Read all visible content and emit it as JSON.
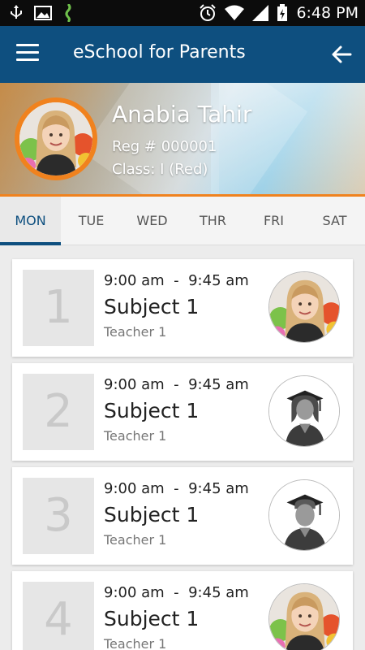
{
  "status_bar": {
    "time": "6:48 PM",
    "icons": [
      "usb-icon",
      "image-icon",
      "app-notification-icon",
      "alarm-icon",
      "wifi-icon",
      "signal-icon",
      "battery-charging-icon"
    ]
  },
  "app_bar": {
    "title": "eSchool for Parents",
    "menu_icon": "hamburger-menu-icon",
    "back_icon": "arrow-back-icon",
    "color": "#0e4f7f"
  },
  "profile": {
    "name": "Anabia Tahir",
    "reg": "Reg # 000001",
    "class": "Class: I (Red)",
    "ring_color": "#f0821e"
  },
  "tabs": [
    {
      "label": "MON",
      "active": true
    },
    {
      "label": "TUE",
      "active": false
    },
    {
      "label": "WED",
      "active": false
    },
    {
      "label": "THR",
      "active": false
    },
    {
      "label": "FRI",
      "active": false
    },
    {
      "label": "SAT",
      "active": false
    }
  ],
  "schedule": [
    {
      "period": "1",
      "start": "9:00 am",
      "end": "9:45 am",
      "subject": "Subject 1",
      "teacher": "Teacher 1",
      "avatar": "student-photo"
    },
    {
      "period": "2",
      "start": "9:00 am",
      "end": "9:45 am",
      "subject": "Subject 1",
      "teacher": "Teacher 1",
      "avatar": "female-graduate-avatar"
    },
    {
      "period": "3",
      "start": "9:00 am",
      "end": "9:45 am",
      "subject": "Subject 1",
      "teacher": "Teacher 1",
      "avatar": "male-graduate-avatar"
    },
    {
      "period": "4",
      "start": "9:00 am",
      "end": "9:45 am",
      "subject": "Subject 1",
      "teacher": "Teacher 1",
      "avatar": "student-photo"
    }
  ]
}
